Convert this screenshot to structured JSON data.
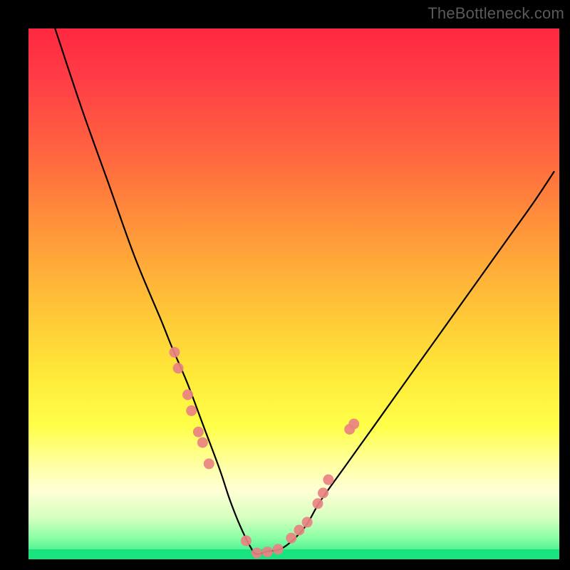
{
  "watermark": "TheBottleneck.com",
  "colors": {
    "page_bg": "#000000",
    "curve_stroke": "#000000",
    "marker_fill": "#e98282",
    "green_strip": "#19e37f",
    "gradient_top": "#ff2840",
    "gradient_bottom": "#22e888",
    "watermark_text": "#5a5a5a"
  },
  "chart_data": {
    "type": "line",
    "title": "",
    "xlabel": "",
    "ylabel": "",
    "xlim": [
      0,
      100
    ],
    "ylim": [
      0,
      100
    ],
    "legend": false,
    "grid": false,
    "description": "V-shaped bottleneck curve over a vertical red→yellow→green gradient. Left branch descends steeply from top-left toward the valley near x≈43; right branch rises with decreasing slope toward upper right. Pink scatter markers lie along both branches near the valley.",
    "series": [
      {
        "name": "bottleneck-curve",
        "x": [
          5,
          10,
          15,
          20,
          25,
          27,
          30,
          33,
          36,
          38,
          40,
          42,
          43,
          45,
          48,
          52,
          55,
          60,
          65,
          70,
          75,
          80,
          85,
          90,
          95,
          99
        ],
        "y": [
          100,
          85,
          71,
          57,
          45,
          40,
          33,
          25,
          17,
          11,
          6,
          2,
          1,
          1.5,
          2.2,
          6,
          11,
          18,
          25,
          32,
          39,
          46,
          53,
          60,
          67,
          73
        ]
      }
    ],
    "markers": [
      {
        "x": 27.5,
        "y": 39
      },
      {
        "x": 28.2,
        "y": 36
      },
      {
        "x": 30.0,
        "y": 31
      },
      {
        "x": 30.7,
        "y": 28
      },
      {
        "x": 32.0,
        "y": 24
      },
      {
        "x": 32.8,
        "y": 22
      },
      {
        "x": 34.0,
        "y": 18
      },
      {
        "x": 41.0,
        "y": 3.5
      },
      {
        "x": 43.0,
        "y": 1.2
      },
      {
        "x": 45.0,
        "y": 1.4
      },
      {
        "x": 47.0,
        "y": 1.9
      },
      {
        "x": 49.5,
        "y": 4.0
      },
      {
        "x": 51.0,
        "y": 5.5
      },
      {
        "x": 52.5,
        "y": 7.0
      },
      {
        "x": 54.5,
        "y": 10.5
      },
      {
        "x": 55.5,
        "y": 12.5
      },
      {
        "x": 56.5,
        "y": 15.0
      },
      {
        "x": 60.5,
        "y": 24.5
      },
      {
        "x": 61.3,
        "y": 25.5
      }
    ]
  }
}
